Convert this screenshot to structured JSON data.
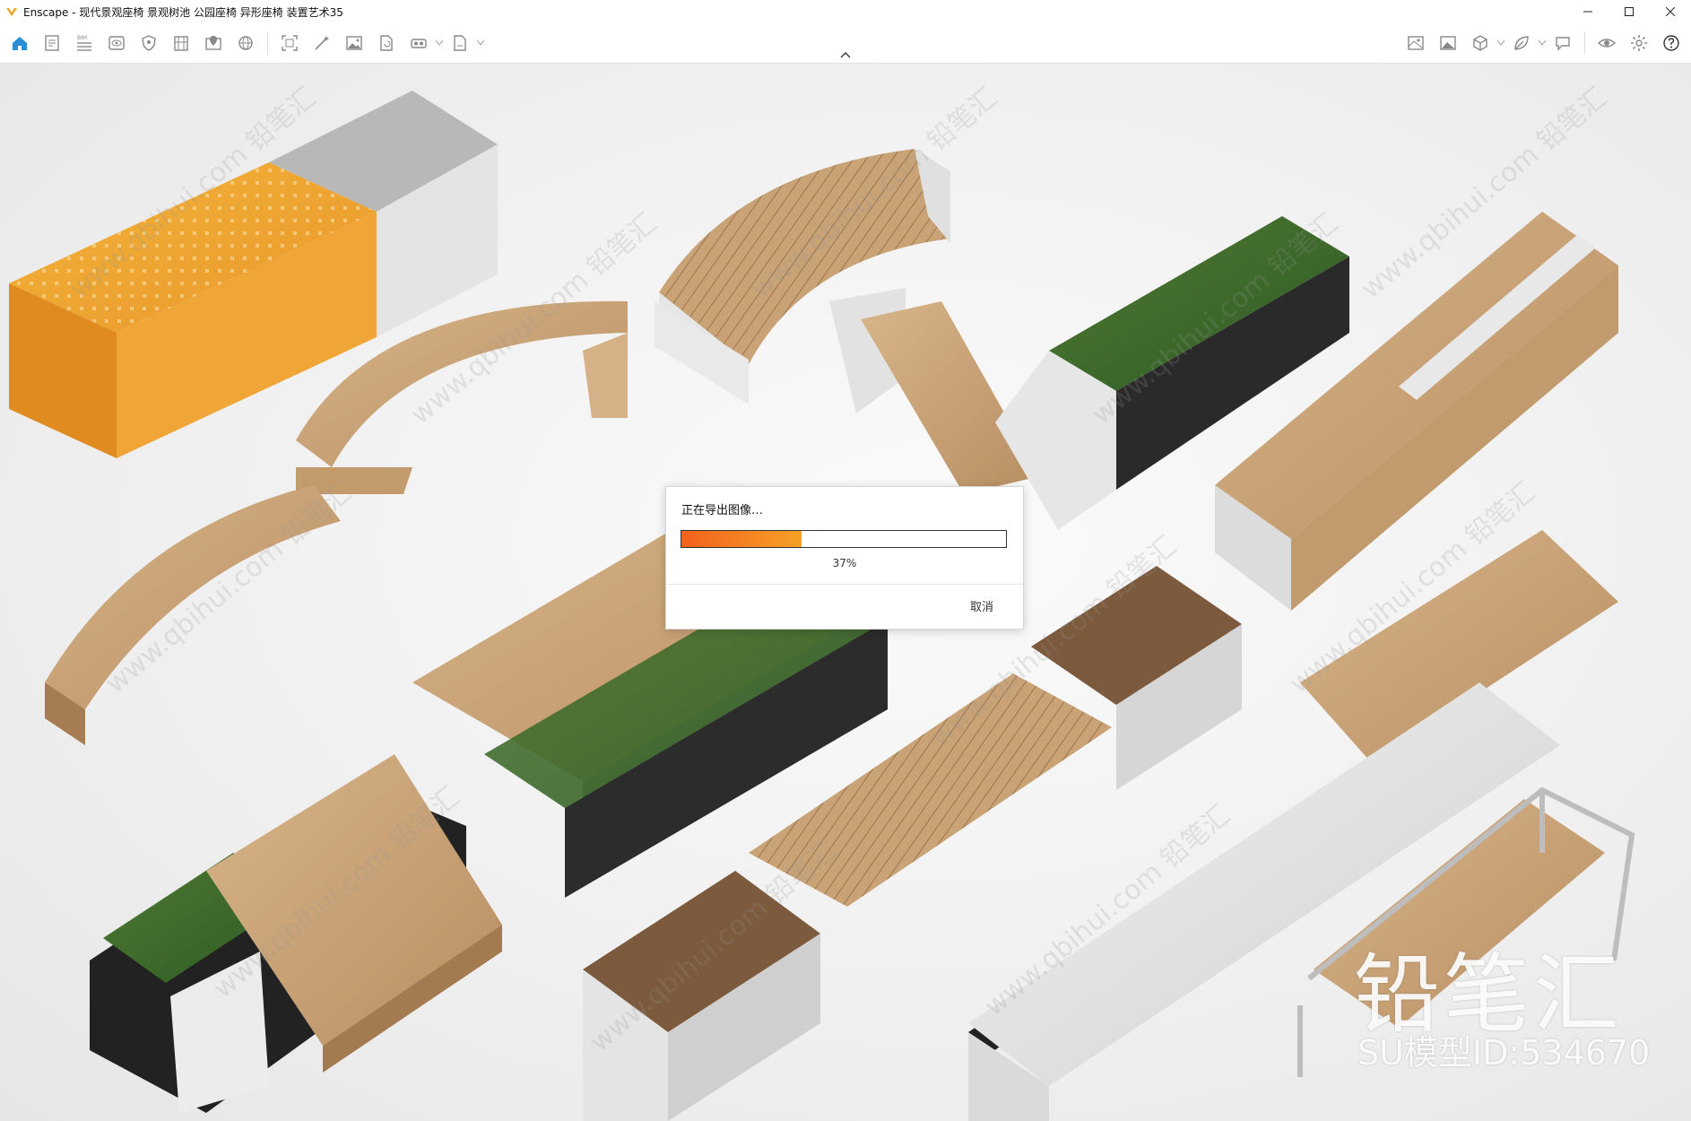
{
  "window": {
    "title": "Enscape - 现代景观座椅 景观树池 公园座椅 异形座椅 装置艺术35",
    "minimize_icon": "minimize-icon",
    "maximize_icon": "maximize-icon",
    "close_icon": "close-icon"
  },
  "toolbar": {
    "left_buttons": [
      {
        "name": "home-icon",
        "active": true
      },
      {
        "name": "document-icon"
      },
      {
        "name": "bim-icon",
        "label": "BIM"
      },
      {
        "name": "eye-box-icon"
      },
      {
        "name": "shield-icon"
      },
      {
        "name": "building-icon"
      },
      {
        "name": "pin-map-icon"
      },
      {
        "name": "globe-icon"
      },
      {
        "name": "frame-icon"
      },
      {
        "name": "magic-wand-icon"
      },
      {
        "name": "image-icon"
      },
      {
        "name": "file-refresh-icon"
      },
      {
        "name": "vr-headset-icon",
        "dropdown": true
      },
      {
        "name": "export-file-icon",
        "dropdown": true
      }
    ],
    "right_buttons": [
      {
        "name": "map-icon"
      },
      {
        "name": "gallery-icon"
      },
      {
        "name": "cube-icon",
        "dropdown": true
      },
      {
        "name": "leaf-icon",
        "dropdown": true
      },
      {
        "name": "chat-icon"
      },
      {
        "name": "visibility-icon"
      },
      {
        "name": "settings-icon"
      },
      {
        "name": "help-icon"
      }
    ],
    "accent_color": "#2a8fd8"
  },
  "dialog": {
    "title": "正在导出图像…",
    "progress": 0.37,
    "progress_label": "37%",
    "cancel_label": "取消",
    "progress_colors": [
      "#f2611d",
      "#f7a126"
    ]
  },
  "watermark": {
    "brand": "铅笔汇",
    "model_id": "SU模型ID:534670",
    "tile_text": "www.qbihui.com 铅笔汇"
  }
}
